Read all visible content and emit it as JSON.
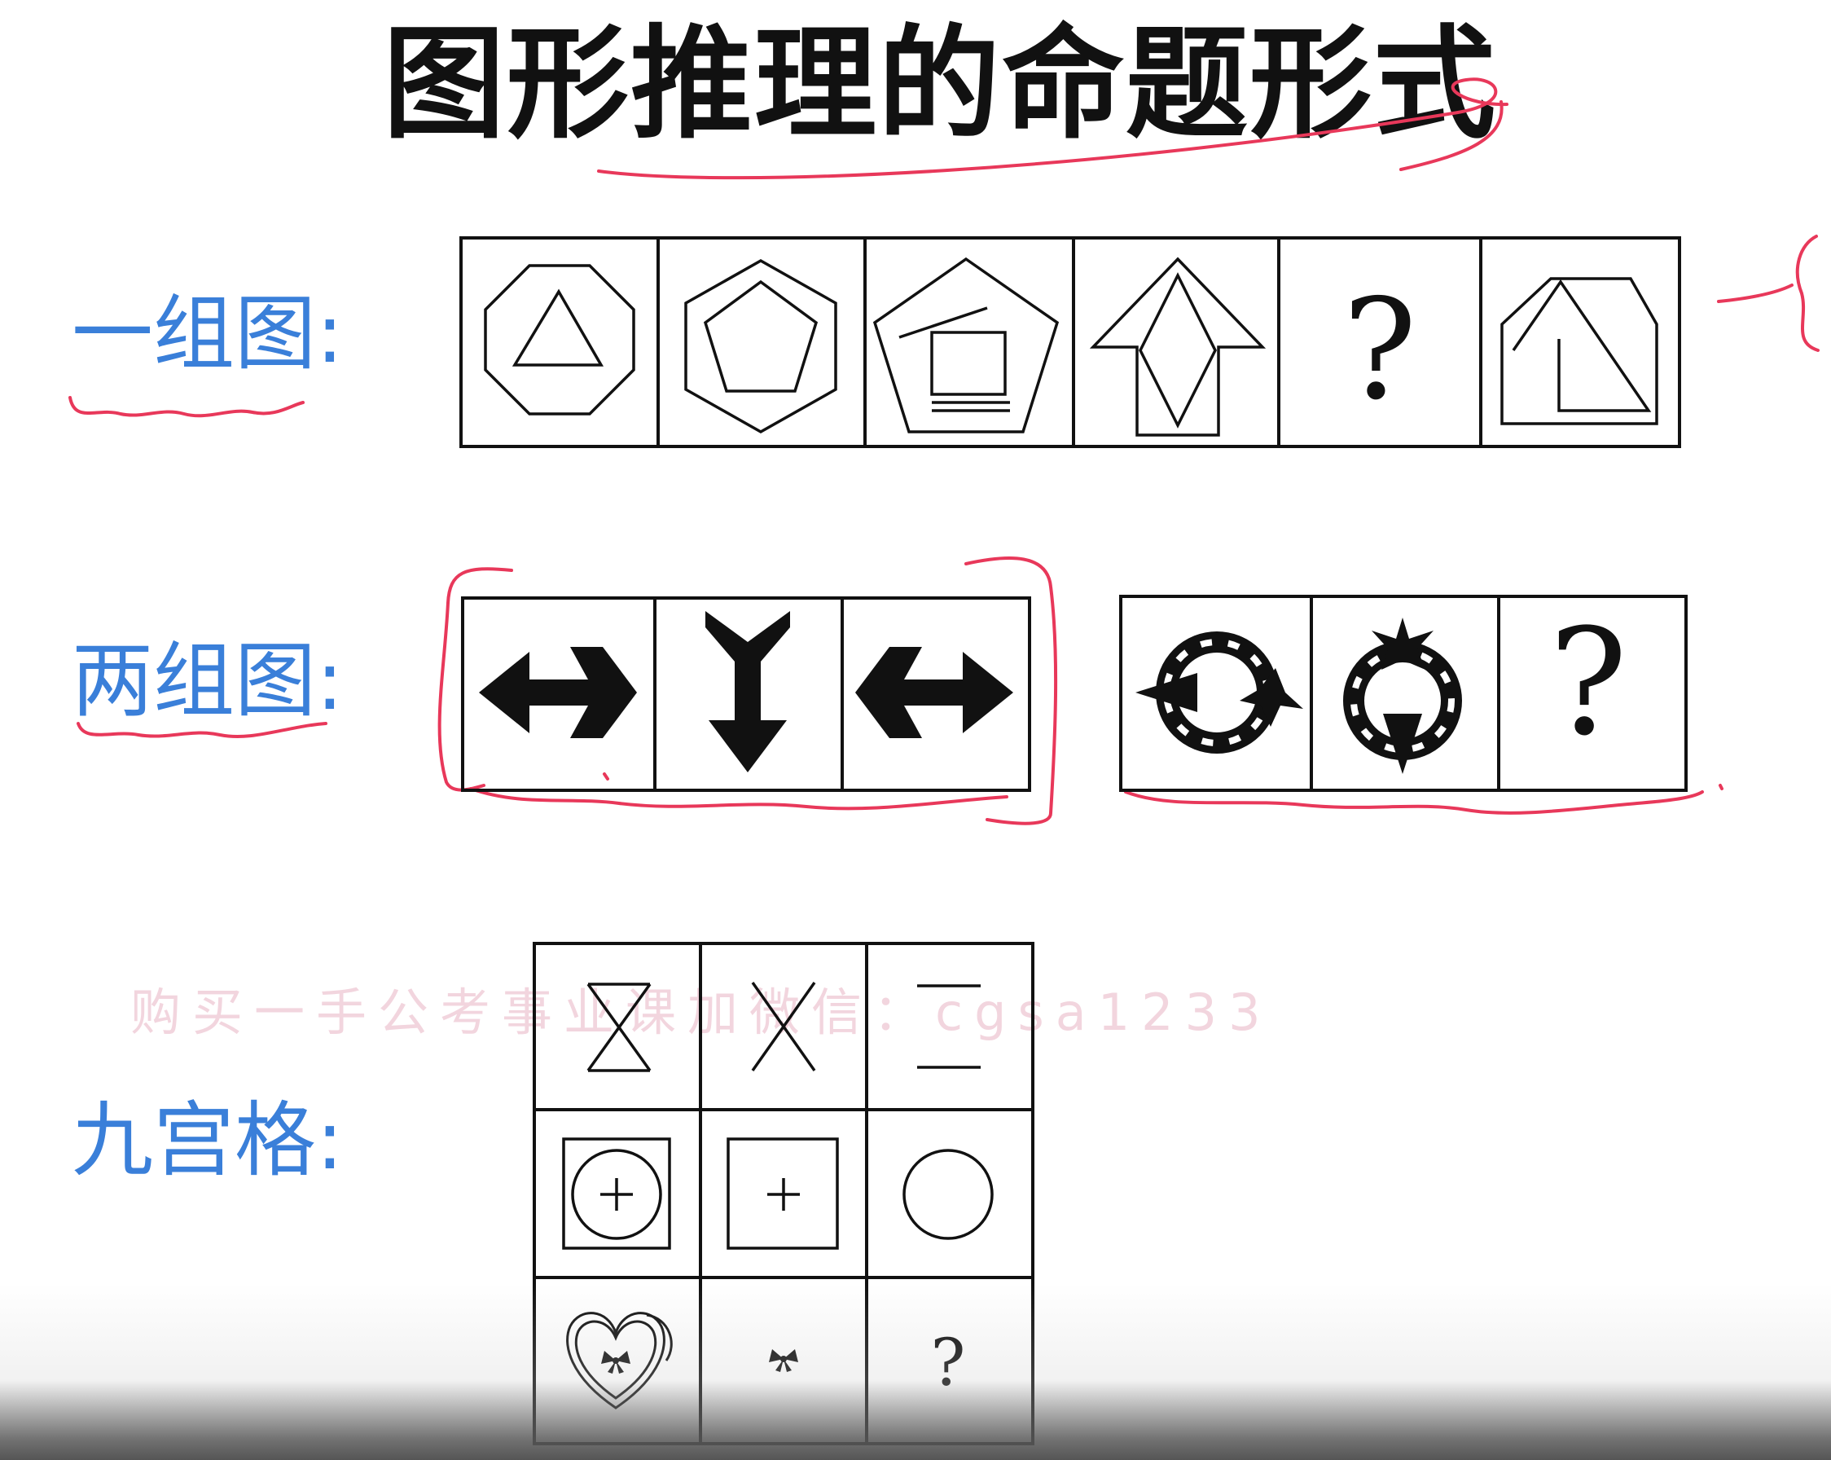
{
  "title": "图形推理的命题形式",
  "sections": {
    "one_group": {
      "label": "一组图:"
    },
    "two_groups": {
      "label": "两组图:"
    },
    "nine_grid": {
      "label": "九宫格:"
    }
  },
  "question_mark": "?",
  "watermark": "购买一手公考事业课加微信：cgsa1233",
  "colors": {
    "title": "#111111",
    "label": "#3a7fd9",
    "annotation": "#e8385a",
    "figure": "#111111"
  },
  "icons": [
    "octagon-with-triangle-icon",
    "hexagon-with-pentagon-icon",
    "pentagon-with-square-icon",
    "arrow-with-diamond-icon",
    "house-with-trapezoid-icon",
    "arrow-left-forked-icon",
    "arrow-down-forked-icon",
    "arrow-right-forked-icon",
    "dashed-circle-with-star-icon",
    "hourglass-icon",
    "x-cross-icon",
    "double-line-icon",
    "circle-plus-in-square-icon",
    "plus-in-square-icon",
    "circle-icon",
    "heart-with-bow-icon",
    "bow-icon"
  ]
}
